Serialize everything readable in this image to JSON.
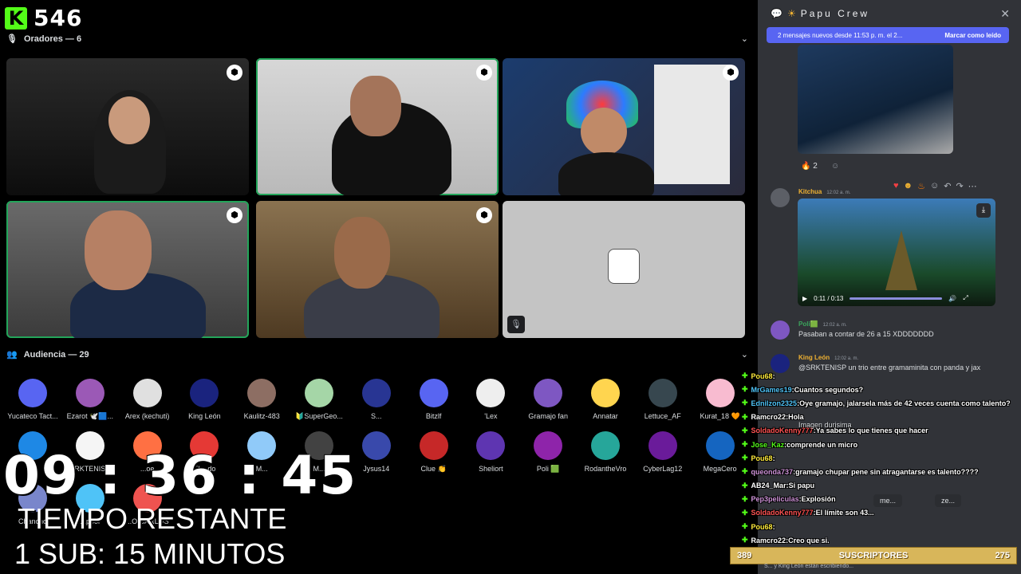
{
  "stream": {
    "viewer_count": "546"
  },
  "speakers_section": {
    "label": "Oradores — 6"
  },
  "audience_section": {
    "label": "Audiencia — 29"
  },
  "audience": [
    {
      "name": "Yucateco Tact...",
      "color": "#5865f2"
    },
    {
      "name": "Ezarot 🕊️🟦...",
      "color": "#9b59b6"
    },
    {
      "name": "Arex (kechuti)",
      "color": "#e0e0e0"
    },
    {
      "name": "King León",
      "color": "#1a237e"
    },
    {
      "name": "Kaulitz-483",
      "color": "#8d6e63"
    },
    {
      "name": "🔰SuperGeo...",
      "color": "#a5d6a7"
    },
    {
      "name": "S...",
      "color": "#283593"
    },
    {
      "name": "Bitzlf",
      "color": "#5865f2"
    },
    {
      "name": "'Lex",
      "color": "#eeeeee"
    },
    {
      "name": "Gramajo fan",
      "color": "#7e57c2"
    },
    {
      "name": "Annatar",
      "color": "#ffd54f"
    },
    {
      "name": "Lettuce_AF",
      "color": "#37474f"
    },
    {
      "name": "Kurat_18 🧡",
      "color": "#f8bbd0"
    },
    {
      "name": "",
      "color": "#1e88e5"
    },
    {
      "name": "SRKTENISP",
      "color": "#f5f5f5"
    },
    {
      "name": "...oe",
      "color": "#ff7043"
    },
    {
      "name": "El ...do",
      "color": "#e53935"
    },
    {
      "name": "M...",
      "color": "#90caf9"
    },
    {
      "name": "M...",
      "color": "#424242"
    },
    {
      "name": "Jysus14",
      "color": "#3949ab"
    },
    {
      "name": "Clue 👏",
      "color": "#c62828"
    },
    {
      "name": "Sheliort",
      "color": "#5e35b1"
    },
    {
      "name": "Poli 🟩",
      "color": "#8e24aa"
    },
    {
      "name": "RodantheVro",
      "color": "#26a69a"
    },
    {
      "name": "CyberLag12",
      "color": "#6a1b9a"
    },
    {
      "name": "MegaCero",
      "color": "#1565c0"
    },
    {
      "name": "Chancho",
      "color": "#7986cb"
    },
    {
      "name": "...pool",
      "color": "#4fc3f7"
    },
    {
      "name": "...O CARLOS",
      "color": "#ef5350"
    }
  ],
  "overlay": {
    "timer": "09 : 36 : 45",
    "tiempo_label": "TIEMPO RESTANTE",
    "sub_rule": "1 SUB: 15 MINUTOS",
    "subbar": {
      "left": "389",
      "center": "SUSCRIPTORES",
      "right": "275"
    }
  },
  "channel": {
    "title": "Papu Crew",
    "new_messages": "2 mensajes nuevos desde 11:53 p. m. el 2...",
    "mark_read": "Marcar como leído"
  },
  "reactions": {
    "fire_count": "2"
  },
  "messages": [
    {
      "author": "Kitchua",
      "time": "12:02 a. m.",
      "text": "",
      "author_color": "#f0b232"
    },
    {
      "author": "Poli🟩",
      "time": "12:02 a. m.",
      "text": "Pasaban a contar de 26 a 15 XDDDDDDD",
      "author_color": "#3ba55c"
    },
    {
      "author": "King León",
      "time": "12:02 a. m.",
      "text": "@SRKTENISP un trio entre gramaminita con panda y jax",
      "author_color": "#f0b232"
    }
  ],
  "video": {
    "time": "0:11 / 0:13"
  },
  "overlay_chat": [
    {
      "user": "Pou68",
      "msg": "",
      "color": "#ffeb3b"
    },
    {
      "user": "MrGames19",
      "msg": "Cuantos segundos?",
      "color": "#4fc3f7"
    },
    {
      "user": "Ednilzon2325",
      "msg": "Oye gramajo, jalarsela más de 42 veces cuenta como talento?",
      "color": "#4fc3f7"
    },
    {
      "user": "Ramcro22",
      "msg": "Hola",
      "color": "#ffffff"
    },
    {
      "user": "SoldadoKenny777",
      "msg": "Ya sabes lo que tienes que hacer",
      "color": "#ff5252"
    },
    {
      "user": "Jose_Kaz",
      "msg": "comprende un micro",
      "color": "#53fc18"
    },
    {
      "user": "Pou68",
      "msg": "",
      "color": "#ffeb3b"
    },
    {
      "user": "queonda737",
      "msg": "gramajo chupar pene sin atragantarse es talento????",
      "color": "#ce93d8"
    },
    {
      "user": "AB24_Mar",
      "msg": "Si papu",
      "color": "#ffffff"
    },
    {
      "user": "Pep3peliculas",
      "msg": "Explosión",
      "color": "#ce93d8"
    },
    {
      "user": "SoldadoKenny777",
      "msg": "El límite son 43...",
      "color": "#ff5252"
    },
    {
      "user": "Pou68",
      "msg": "",
      "color": "#ffeb3b"
    },
    {
      "user": "Ramcro22",
      "msg": "Creo que si.",
      "color": "#ffffff"
    }
  ],
  "side_fragments": {
    "imagen": "Imagen durisima",
    "bubble_me": "me...",
    "bubble_ze": "ze..."
  },
  "typing": "S... y King León están escribiendo..."
}
